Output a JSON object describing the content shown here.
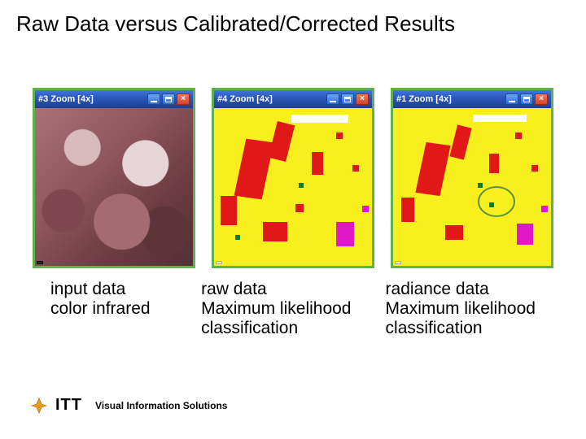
{
  "title": "Raw Data versus Calibrated/Corrected Results",
  "panels": [
    {
      "window_title": "#3 Zoom [4x]",
      "coords": ""
    },
    {
      "window_title": "#4 Zoom [4x]",
      "coords": ""
    },
    {
      "window_title": "#1 Zoom [4x]",
      "coords": ""
    }
  ],
  "captions": [
    "input data\ncolor infrared",
    "raw data\nMaximum likelihood\nclassification",
    "radiance data\nMaximum likelihood\nclassification"
  ],
  "footer": {
    "brand": "ITT",
    "tagline": "Visual Information Solutions"
  }
}
